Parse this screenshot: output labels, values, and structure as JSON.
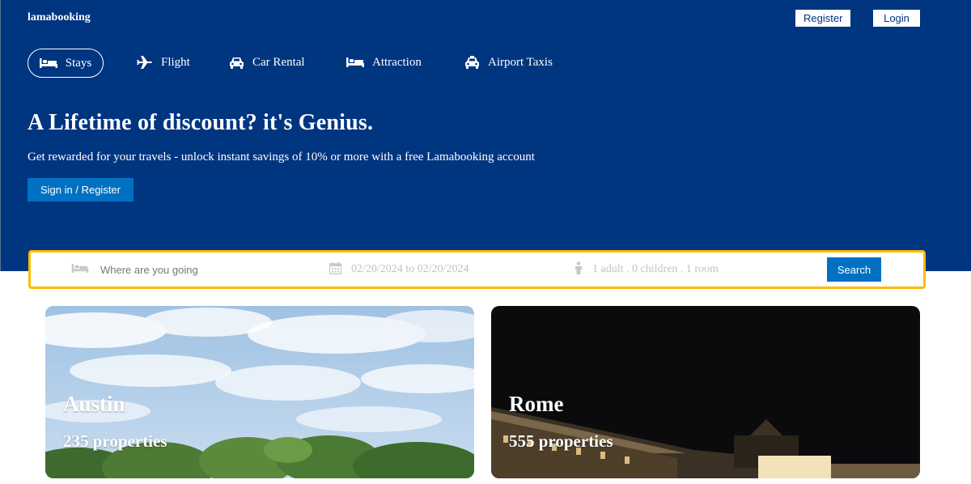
{
  "header": {
    "logo": "lamabooking",
    "register_label": "Register",
    "login_label": "Login"
  },
  "tabs": [
    {
      "label": "Stays",
      "icon": "bed-icon",
      "active": true
    },
    {
      "label": "Flight",
      "icon": "plane-icon",
      "active": false
    },
    {
      "label": "Car Rental",
      "icon": "car-icon",
      "active": false
    },
    {
      "label": "Attraction",
      "icon": "bed-icon",
      "active": false
    },
    {
      "label": "Airport Taxis",
      "icon": "taxi-icon",
      "active": false
    }
  ],
  "hero": {
    "title": "A Lifetime of discount? it's Genius.",
    "description": "Get rewarded for your travels - unlock instant savings of 10% or more with a free Lamabooking account",
    "signin_label": "Sign in / Register"
  },
  "search": {
    "destination_placeholder": "Where are you going",
    "date_range": "02/20/2024 to 02/20/2024",
    "guests": "1 adult . 0 children . 1 room",
    "button_label": "Search"
  },
  "featured": [
    {
      "city": "Austin",
      "properties": "235 properties"
    },
    {
      "city": "Rome",
      "properties": "555 properties"
    }
  ],
  "colors": {
    "brand": "#003580",
    "accent_button": "#0071c2",
    "search_border": "#febb02"
  }
}
